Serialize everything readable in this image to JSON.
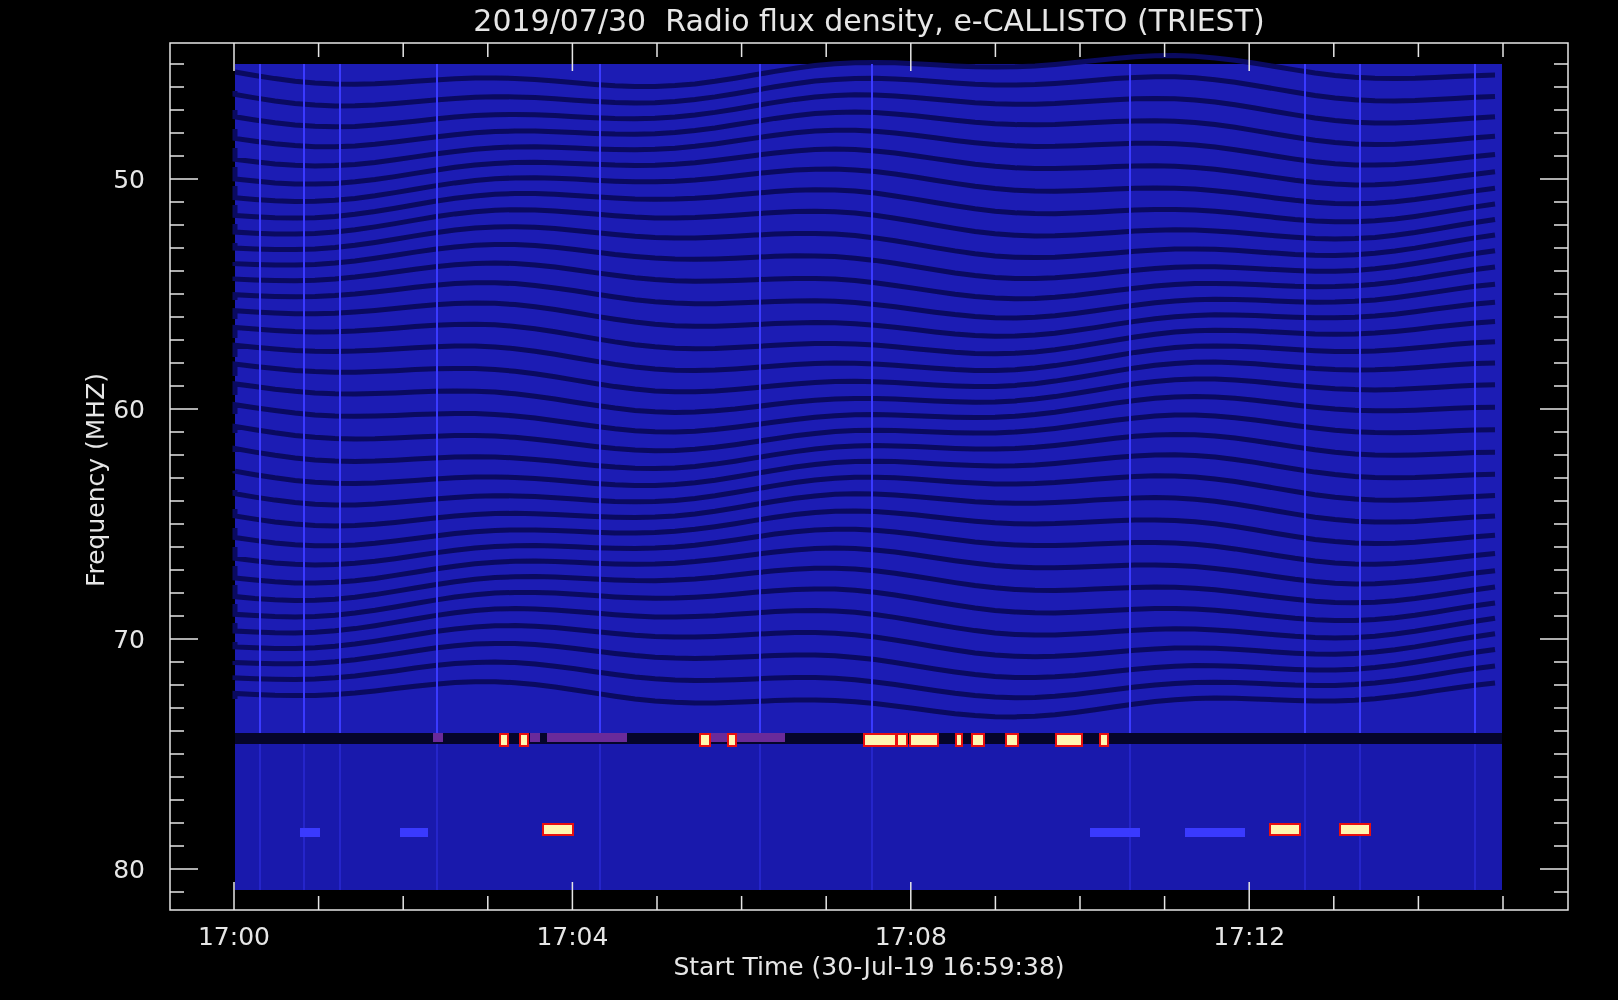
{
  "plot": {
    "title": "2019/07/30  Radio flux density, e-CALLISTO (TRIEST)",
    "xlabel": "Start Time (30-Jul-19 16:59:38)",
    "ylabel": "Frequency (MHZ)",
    "x_ticks": [
      "17:00",
      "17:04",
      "17:08",
      "17:12"
    ],
    "y_ticks": [
      "50",
      "60",
      "70",
      "80"
    ]
  }
}
